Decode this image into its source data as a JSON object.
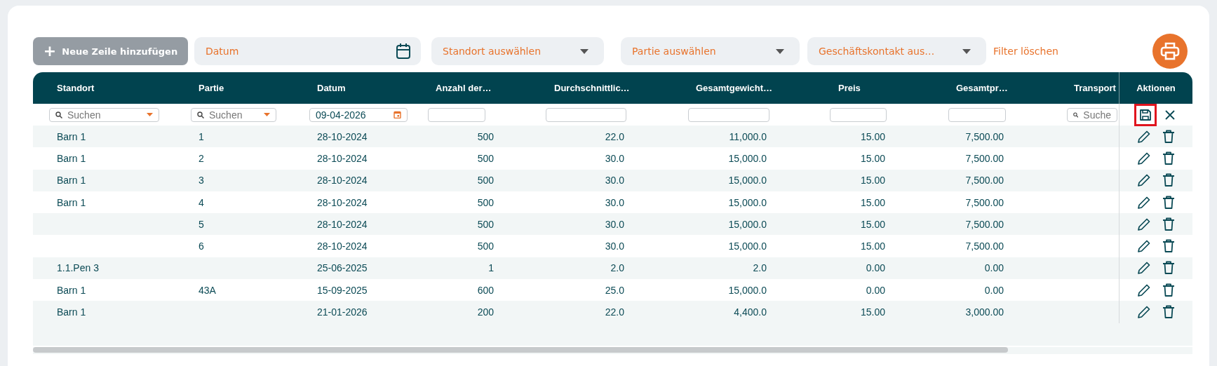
{
  "toolbar": {
    "add_button": {
      "label": "Neue Zeile hinzufügen",
      "icon": "+",
      "disabled": true
    },
    "date_filter": {
      "placeholder": "Datum"
    },
    "dropdowns": [
      {
        "placeholder": "Standort auswählen"
      },
      {
        "placeholder": "Partie auswählen"
      },
      {
        "placeholder": "Geschäftskontakt aus…"
      }
    ],
    "clear_filters": "Filter löschen"
  },
  "table": {
    "columns": [
      {
        "label": "Standort",
        "filter": {
          "kind": "select",
          "placeholder": "Suchen"
        }
      },
      {
        "label": "Partie",
        "filter": {
          "kind": "select",
          "placeholder": "Suchen"
        }
      },
      {
        "label": "Datum",
        "filter": {
          "kind": "date",
          "value": "09-04-2026"
        }
      },
      {
        "label": "Anzahl der…",
        "filter": {
          "kind": "text"
        }
      },
      {
        "label": "Durchschnittlic…",
        "filter": {
          "kind": "text"
        }
      },
      {
        "label": "Gesamtgewicht…",
        "filter": {
          "kind": "text"
        }
      },
      {
        "label": "Preis",
        "filter": {
          "kind": "text"
        }
      },
      {
        "label": "Gesamtpr…",
        "filter": {
          "kind": "text"
        }
      },
      {
        "label": "Transport",
        "filter": {
          "kind": "search",
          "placeholder": "Suche"
        }
      }
    ],
    "actions_column": {
      "label": "Aktionen",
      "filter_actions": [
        {
          "kind": "save",
          "highlighted": true
        },
        {
          "kind": "cancel",
          "highlighted": false
        }
      ]
    },
    "rows": [
      {
        "cells": [
          "Barn 1",
          "1",
          "28-10-2024",
          "500",
          "22.0",
          "11,000.0",
          "15.00",
          "7,500.00"
        ]
      },
      {
        "cells": [
          "Barn 1",
          "2",
          "28-10-2024",
          "500",
          "30.0",
          "15,000.0",
          "15.00",
          "7,500.00"
        ]
      },
      {
        "cells": [
          "Barn 1",
          "3",
          "28-10-2024",
          "500",
          "30.0",
          "15,000.0",
          "15.00",
          "7,500.00"
        ]
      },
      {
        "cells": [
          "Barn 1",
          "4",
          "28-10-2024",
          "500",
          "30.0",
          "15,000.0",
          "15.00",
          "7,500.00"
        ]
      },
      {
        "cells": [
          null,
          "5",
          "28-10-2024",
          "500",
          "30.0",
          "15,000.0",
          "15.00",
          "7,500.00"
        ]
      },
      {
        "cells": [
          null,
          "6",
          "28-10-2024",
          "500",
          "30.0",
          "15,000.0",
          "15.00",
          "7,500.00"
        ]
      },
      {
        "cells": [
          "1.1.Pen 3",
          null,
          "25-06-2025",
          "1",
          "2.0",
          "2.0",
          "0.00",
          "0.00"
        ]
      },
      {
        "cells": [
          "Barn 1",
          "43A",
          "15-09-2025",
          "600",
          "25.0",
          "15,000.0",
          "0.00",
          "0.00"
        ]
      },
      {
        "cells": [
          "Barn 1",
          null,
          "21-01-2026",
          "200",
          "22.0",
          "4,400.0",
          "15.00",
          "3,000.00"
        ]
      }
    ]
  }
}
